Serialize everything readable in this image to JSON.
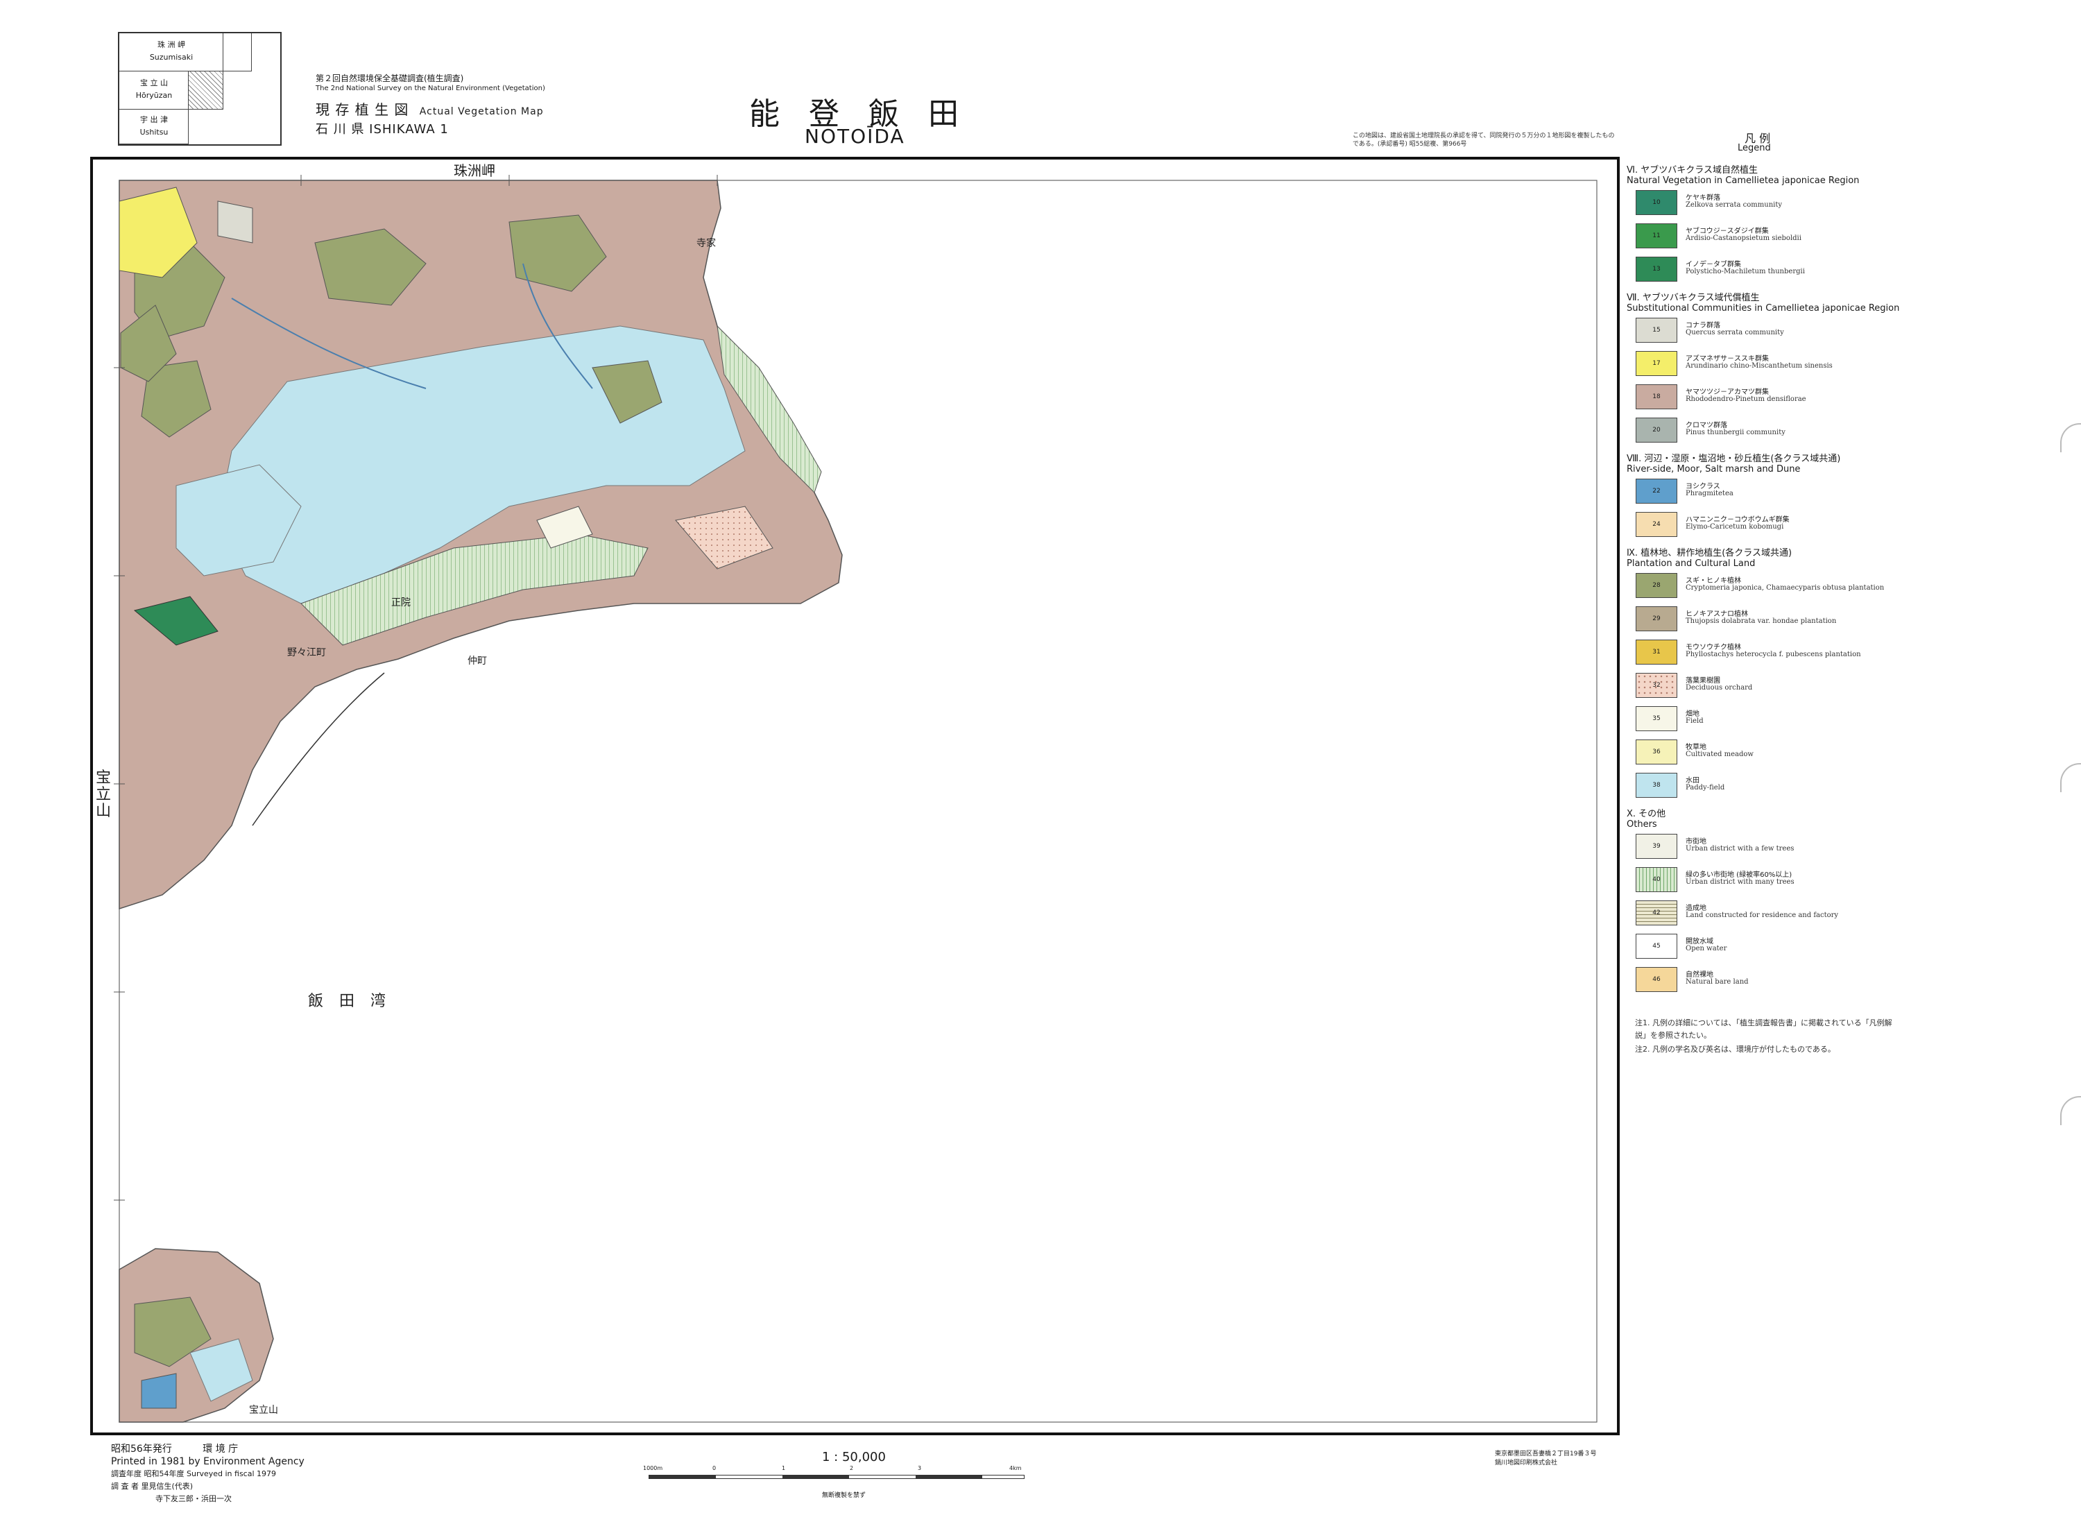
{
  "index_grid": {
    "cells": [
      {
        "ja": "珠 洲 岬",
        "en": "Suzumisaki"
      },
      {
        "ja": "宝 立 山",
        "en": "Hōryūzan"
      },
      {
        "ja": "宇 出 津",
        "en": "Ushitsu"
      }
    ]
  },
  "header": {
    "survey_ja": "第２回自然環境保全基礎調査(植生調査)",
    "survey_en": "The 2nd National Survey on the Natural Environment (Vegetation)",
    "map_type_ja": "現 存 植 生 図",
    "map_type_en": "Actual Vegetation Map",
    "prefecture": "石 川 県  ISHIKAWA 1",
    "title_ja": "能 登 飯 田",
    "title_en": "NOTOĪDA",
    "note": "この地図は、建設省国土地理院長の承認を得て、同院発行の５万分の１地形図を複製したものである。(承認番号) 昭55総複、第966号"
  },
  "map": {
    "top_label": "珠洲岬",
    "west_label": "宝立山",
    "bay_label": "飯 田 湾",
    "town_labels": [
      "野々江町",
      "仲町",
      "正院",
      "寺家",
      "宝立山"
    ]
  },
  "legend": {
    "title_ja": "凡 例",
    "title_en": "Legend",
    "sections": [
      {
        "header_ja": "Ⅵ. ヤブツバキクラス域自然植生",
        "header_en": "Natural Vegetation in Camellietea japonicae Region",
        "items": [
          {
            "code": "10",
            "ja": "ケヤキ群落",
            "en": "Zelkova serrata community",
            "color": "#2f8a6c"
          },
          {
            "code": "11",
            "ja": "ヤブコウジ－スダジイ群集",
            "en": "Ardisio-Castanopsietum sieboldii",
            "color": "#3a9a4c"
          },
          {
            "code": "13",
            "ja": "イノデ－タブ群集",
            "en": "Polysticho-Machiletum thunbergii",
            "color": "#2e8b57"
          }
        ]
      },
      {
        "header_ja": "Ⅶ. ヤブツバキクラス域代償植生",
        "header_en": "Substitutional Communities in Camellietea japonicae Region",
        "items": [
          {
            "code": "15",
            "ja": "コナラ群落",
            "en": "Quercus serrata community",
            "color": "#dcdcd2"
          },
          {
            "code": "17",
            "ja": "アズマネザサ－ススキ群集",
            "en": "Arundinario chino-Miscanthetum sinensis",
            "color": "#f4ee6a"
          },
          {
            "code": "18",
            "ja": "ヤマツツジ－アカマツ群集",
            "en": "Rhododendro-Pinetum densiflorae",
            "color": "#c9aba0"
          },
          {
            "code": "20",
            "ja": "クロマツ群落",
            "en": "Pinus thunbergii community",
            "color": "#a9b4ae"
          }
        ]
      },
      {
        "header_ja": "Ⅷ. 河辺・湿原・塩沼地・砂丘植生(各クラス域共通)",
        "header_en": "River-side, Moor, Salt marsh and Dune",
        "items": [
          {
            "code": "22",
            "ja": "ヨシクラス",
            "en": "Phragmitetea",
            "color": "#5f9fcc"
          },
          {
            "code": "24",
            "ja": "ハマニンニク－コウボウムギ群集",
            "en": "Elymo-Caricetum kobomugi",
            "color": "#f6ddb0"
          }
        ]
      },
      {
        "header_ja": "Ⅸ. 植林地、耕作地植生(各クラス域共通)",
        "header_en": "Plantation and Cultural Land",
        "items": [
          {
            "code": "28",
            "ja": "スギ・ヒノキ植林",
            "en": "Cryptomeria japonica, Chamaecyparis obtusa plantation",
            "color": "#9aa670"
          },
          {
            "code": "29",
            "ja": "ヒノキアスナロ植林",
            "en": "Thujopsis dolabrata var. hondae plantation",
            "color": "#b8aa90"
          },
          {
            "code": "31",
            "ja": "モウソウチク植林",
            "en": "Phyllostachys heterocycla f. pubescens plantation",
            "color": "#e8c64a"
          },
          {
            "code": "32",
            "ja": "落葉果樹園",
            "en": "Deciduous orchard",
            "color": "#f4d6c8"
          },
          {
            "code": "35",
            "ja": "畑地",
            "en": "Field",
            "color": "#f7f6e8"
          },
          {
            "code": "36",
            "ja": "牧草地",
            "en": "Cultivated meadow",
            "color": "#f6f2b8"
          },
          {
            "code": "38",
            "ja": "水田",
            "en": "Paddy-field",
            "color": "#bfe4ee"
          }
        ]
      },
      {
        "header_ja": "Ⅹ. その他",
        "header_en": "Others",
        "items": [
          {
            "code": "39",
            "ja": "市街地",
            "en": "Urban district with a few trees",
            "color": "#f1f1e6"
          },
          {
            "code": "40",
            "ja": "緑の多い市街地 (緑被率60%以上)",
            "en": "Urban district with many trees",
            "color": "#d9ead0"
          },
          {
            "code": "42",
            "ja": "造成地",
            "en": "Land constructed for residence and factory",
            "color": "#ece8cf"
          },
          {
            "code": "45",
            "ja": "開放水域",
            "en": "Open water",
            "color": "#ffffff"
          },
          {
            "code": "46",
            "ja": "自然裸地",
            "en": "Natural bare land",
            "color": "#f5d79a"
          }
        ]
      }
    ],
    "notes": [
      "注1. 凡例の詳細については、「植生調査報告書」に掲載されている「凡例解説」を参照されたい。",
      "注2. 凡例の学名及び英名は、環境庁が付したものである。"
    ]
  },
  "footer": {
    "issued_ja": "昭和56年発行",
    "agency_ja": "環 境 庁",
    "printed_en": "Printed in 1981 by Environment Agency",
    "survey_year": "調査年度  昭和54年度  Surveyed in fiscal 1979",
    "surveyors": "調 査 者  里見信生(代表)",
    "surveyors2": "寺下友三郎・浜田一次",
    "scale": "1 : 50,000",
    "scale_ticks": [
      "1000m",
      "0",
      "1",
      "2",
      "3",
      "4km"
    ],
    "copy_note": "無断複製を禁ず",
    "printer": "東京都墨田区吾妻橋２丁目19番３号",
    "printer2": "鍋川地図印刷株式会社"
  }
}
